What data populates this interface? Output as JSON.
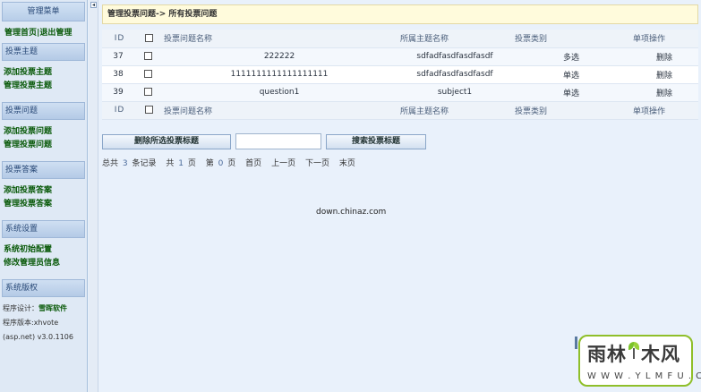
{
  "sidebar": {
    "title": "管理菜单",
    "top_links": [
      "管理首页",
      "退出管理"
    ],
    "top_sep": "|",
    "sections": [
      {
        "title": "投票主题",
        "links": [
          "添加投票主题",
          "管理投票主题"
        ]
      },
      {
        "title": "投票问题",
        "links": [
          "添加投票问题",
          "管理投票问题"
        ]
      },
      {
        "title": "投票答案",
        "links": [
          "添加投票答案",
          "管理投票答案"
        ]
      },
      {
        "title": "系统设置",
        "links": [
          "系统初始配置",
          "修改管理员信息"
        ]
      }
    ],
    "copyright_title": "系统版权",
    "designer_label": "程序设计：",
    "designer_name": "雪晖软件",
    "version_label": "程序版本:xhvote",
    "version_value": "(asp.net) v3.0.1106"
  },
  "splitter": {
    "arrow": "◂"
  },
  "breadcrumb": "管理投票问题-> 所有投票问题",
  "table": {
    "headers": {
      "id": "ID",
      "name": "投票问题名称",
      "subject": "所属主题名称",
      "type": "投票类别",
      "op": "单项操作"
    },
    "rows": [
      {
        "id": "37",
        "name": "222222",
        "subject": "sdfadfasdfasdfasdf",
        "type": "多选",
        "op": "删除"
      },
      {
        "id": "38",
        "name": "1111111111111111111",
        "subject": "sdfadfasdfasdfasdf",
        "type": "单选",
        "op": "删除"
      },
      {
        "id": "39",
        "name": "question1",
        "subject": "subject1",
        "type": "单选",
        "op": "删除"
      }
    ]
  },
  "actions": {
    "delete_label": "删除所选投票标题",
    "search_value": "",
    "search_label": "搜索投票标题"
  },
  "pager": {
    "total_prefix": "总共",
    "total": "3",
    "total_suffix": "条记录",
    "pages_prefix": "共",
    "pages": "1",
    "pages_suffix": "页",
    "current_prefix": "第",
    "current": "0",
    "current_suffix": "页",
    "first": "首页",
    "prev": "上一页",
    "next": "下一页",
    "last": "末页"
  },
  "footer": "down.chinaz.com",
  "watermark": {
    "cn_left": "雨林",
    "cn_right": "木风",
    "en": "W W W . Y L M F U . C O M"
  },
  "colors": {
    "sidebar_bg": "#dfe9f5",
    "main_bg": "#e9f1fb",
    "link_green": "#0a5a0a",
    "breadcrumb_bg": "#fffbdc",
    "watermark_border": "#8fbf2a"
  }
}
